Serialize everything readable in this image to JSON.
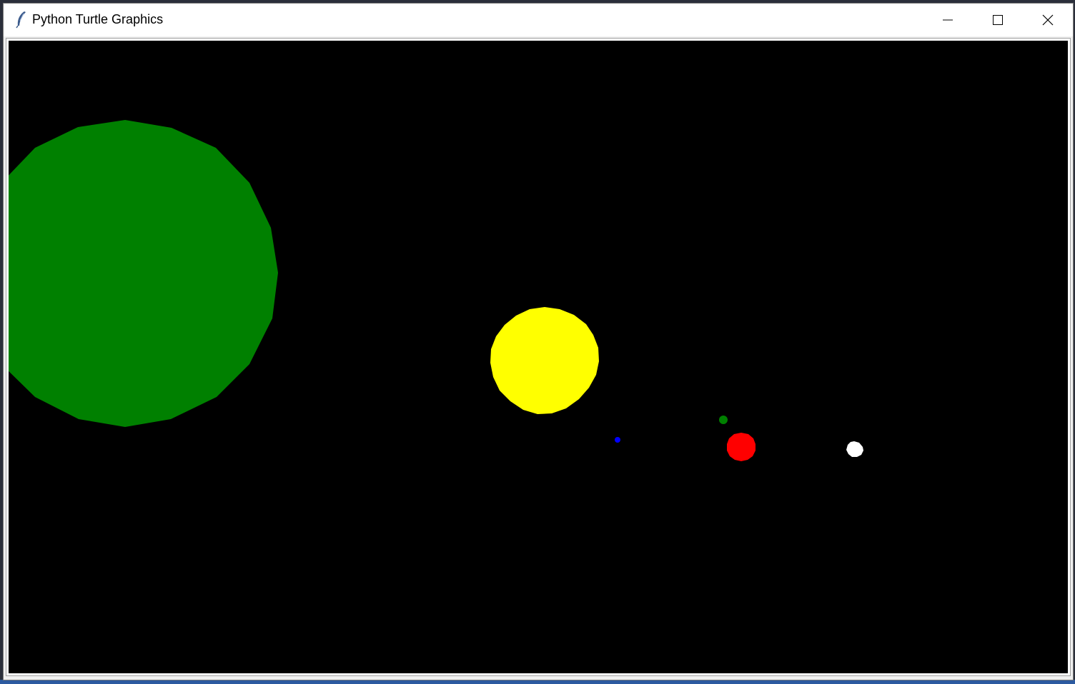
{
  "window": {
    "title": "Python Turtle Graphics",
    "icon": "feather-icon",
    "controls": [
      "minimize-icon",
      "maximize-icon",
      "close-icon"
    ]
  },
  "canvas": {
    "background": "#000000",
    "bodies": [
      {
        "name": "large-green-body",
        "color": "#008000"
      },
      {
        "name": "sun",
        "color": "#ffff00"
      },
      {
        "name": "blue-planet",
        "color": "#0000ff"
      },
      {
        "name": "green-moon",
        "color": "#008000"
      },
      {
        "name": "red-planet",
        "color": "#ff0000"
      },
      {
        "name": "white-planet",
        "color": "#ffffff"
      }
    ]
  }
}
